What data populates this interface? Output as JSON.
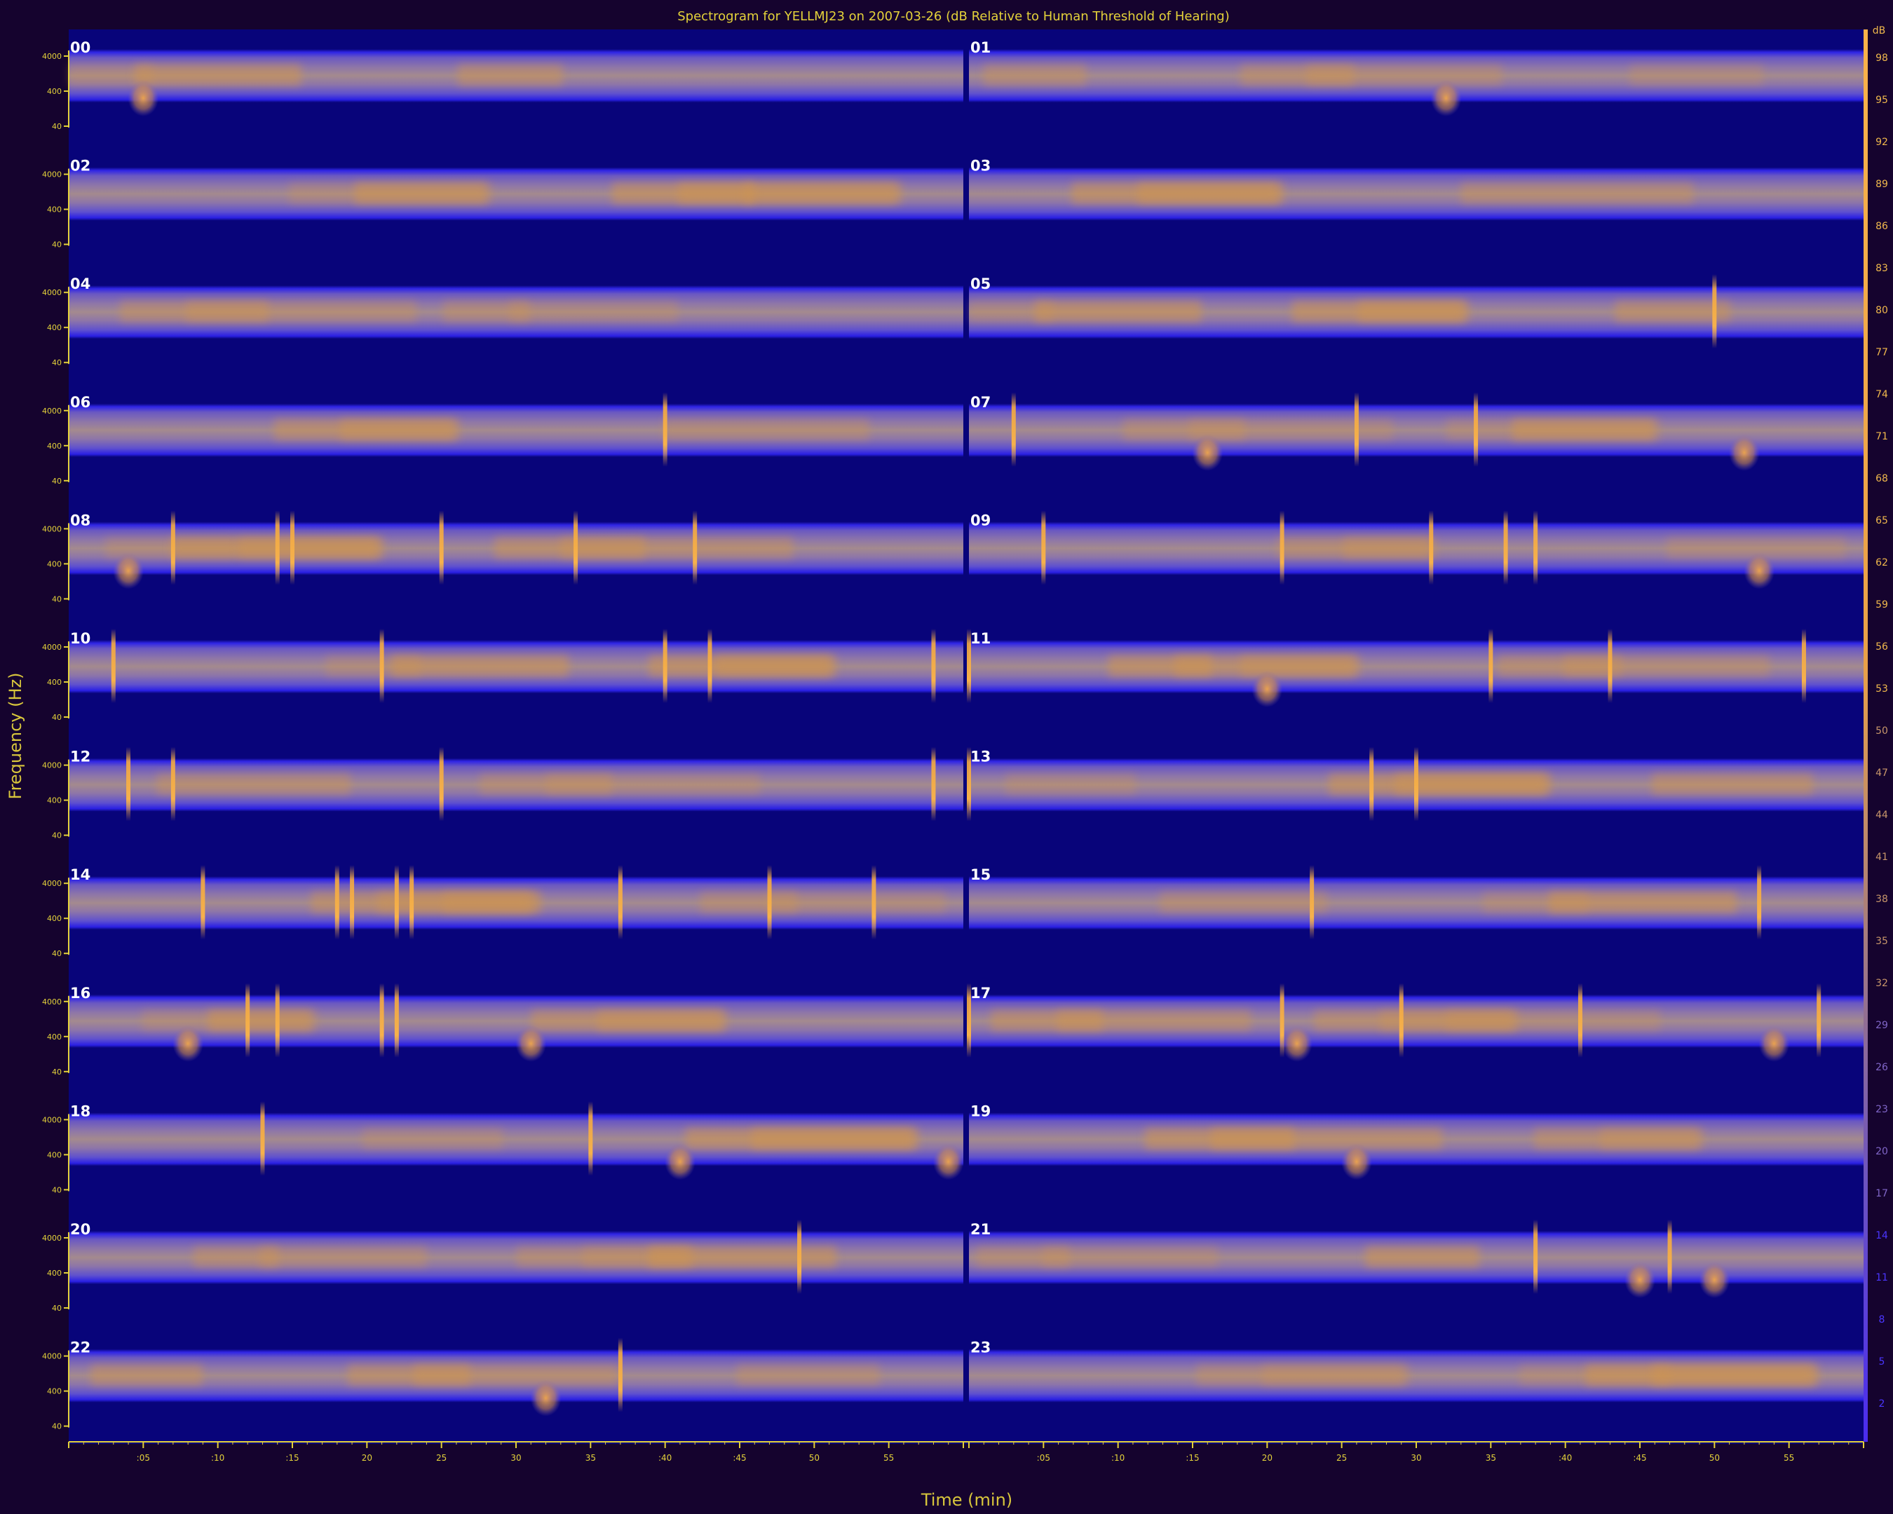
{
  "chart_data": {
    "type": "heatmap",
    "title": "Spectrogram for YELLMJ23 on 2007-03-26 (dB Relative to Human Threshold of Hearing)",
    "xlabel": "Time (min)",
    "ylabel": "Frequency (Hz)",
    "hours": [
      "00",
      "01",
      "02",
      "03",
      "04",
      "05",
      "06",
      "07",
      "08",
      "09",
      "10",
      "11",
      "12",
      "13",
      "14",
      "15",
      "16",
      "17",
      "18",
      "19",
      "20",
      "21",
      "22",
      "23"
    ],
    "frequency_ticks": [
      "4000",
      "400",
      "40"
    ],
    "time_ticks": [
      ":05",
      ":10",
      ":15",
      "20",
      "25",
      "30",
      "35",
      ":40",
      ":45",
      "50",
      "55"
    ],
    "colorbar": {
      "labels": [
        "98",
        "95",
        "92",
        "89",
        "86",
        "83",
        "80",
        "77",
        "74",
        "71",
        "68",
        "65",
        "62",
        "59",
        "56",
        "53",
        "50",
        "47",
        "44",
        "41",
        "38",
        "35",
        "32",
        "29",
        "26",
        "23",
        "20",
        "17",
        "14",
        "11",
        "8",
        "5",
        "2"
      ],
      "top_label": "dB",
      "colors": [
        "#f8b24a",
        "#e39a47",
        "#b57f6c",
        "#7d63b4",
        "#3f33dd",
        "#1a10b8",
        "#08047a"
      ]
    },
    "events": [
      {
        "hour": "06",
        "minute": 40,
        "type": "spike"
      },
      {
        "hour": "07",
        "minute": 3,
        "type": "spike"
      },
      {
        "hour": "07",
        "minute": 26,
        "type": "spike"
      },
      {
        "hour": "07",
        "minute": 34,
        "type": "spike"
      },
      {
        "hour": "08",
        "minute": 7,
        "type": "spike"
      },
      {
        "hour": "08",
        "minute": 14,
        "type": "spike"
      },
      {
        "hour": "08",
        "minute": 15,
        "type": "spike"
      },
      {
        "hour": "08",
        "minute": 25,
        "type": "spike"
      },
      {
        "hour": "08",
        "minute": 34,
        "type": "spike"
      },
      {
        "hour": "08",
        "minute": 42,
        "type": "spike"
      },
      {
        "hour": "09",
        "minute": 5,
        "type": "spike"
      },
      {
        "hour": "09",
        "minute": 21,
        "type": "spike"
      },
      {
        "hour": "09",
        "minute": 31,
        "type": "spike"
      },
      {
        "hour": "09",
        "minute": 36,
        "type": "spike"
      },
      {
        "hour": "09",
        "minute": 38,
        "type": "spike"
      },
      {
        "hour": "10",
        "minute": 3,
        "type": "spike"
      },
      {
        "hour": "10",
        "minute": 21,
        "type": "spike"
      },
      {
        "hour": "10",
        "minute": 40,
        "type": "spike"
      },
      {
        "hour": "10",
        "minute": 43,
        "type": "spike"
      },
      {
        "hour": "10",
        "minute": 58,
        "type": "spike"
      },
      {
        "hour": "11",
        "minute": 0,
        "type": "spike"
      },
      {
        "hour": "11",
        "minute": 35,
        "type": "spike"
      },
      {
        "hour": "11",
        "minute": 43,
        "type": "spike"
      },
      {
        "hour": "11",
        "minute": 56,
        "type": "spike"
      },
      {
        "hour": "12",
        "minute": 4,
        "type": "spike"
      },
      {
        "hour": "12",
        "minute": 7,
        "type": "spike"
      },
      {
        "hour": "12",
        "minute": 25,
        "type": "spike"
      },
      {
        "hour": "12",
        "minute": 58,
        "type": "spike"
      },
      {
        "hour": "13",
        "minute": 0,
        "type": "spike"
      },
      {
        "hour": "13",
        "minute": 27,
        "type": "spike"
      },
      {
        "hour": "13",
        "minute": 30,
        "type": "spike"
      },
      {
        "hour": "14",
        "minute": 9,
        "type": "spike"
      },
      {
        "hour": "14",
        "minute": 18,
        "type": "spike"
      },
      {
        "hour": "14",
        "minute": 19,
        "type": "spike"
      },
      {
        "hour": "14",
        "minute": 22,
        "type": "spike"
      },
      {
        "hour": "14",
        "minute": 23,
        "type": "spike"
      },
      {
        "hour": "14",
        "minute": 37,
        "type": "spike"
      },
      {
        "hour": "14",
        "minute": 47,
        "type": "spike"
      },
      {
        "hour": "14",
        "minute": 54,
        "type": "spike"
      },
      {
        "hour": "15",
        "minute": 23,
        "type": "spike"
      },
      {
        "hour": "15",
        "minute": 53,
        "type": "spike"
      },
      {
        "hour": "16",
        "minute": 12,
        "type": "spike"
      },
      {
        "hour": "16",
        "minute": 14,
        "type": "spike"
      },
      {
        "hour": "16",
        "minute": 21,
        "type": "spike"
      },
      {
        "hour": "16",
        "minute": 22,
        "type": "spike"
      },
      {
        "hour": "17",
        "minute": 0,
        "type": "spike"
      },
      {
        "hour": "17",
        "minute": 21,
        "type": "spike"
      },
      {
        "hour": "17",
        "minute": 29,
        "type": "spike"
      },
      {
        "hour": "17",
        "minute": 41,
        "type": "spike"
      },
      {
        "hour": "17",
        "minute": 57,
        "type": "spike"
      },
      {
        "hour": "18",
        "minute": 13,
        "type": "spike"
      },
      {
        "hour": "18",
        "minute": 35,
        "type": "spike"
      },
      {
        "hour": "20",
        "minute": 49,
        "type": "spike"
      },
      {
        "hour": "21",
        "minute": 38,
        "type": "spike"
      },
      {
        "hour": "21",
        "minute": 47,
        "type": "spike"
      },
      {
        "hour": "22",
        "minute": 37,
        "type": "spike"
      },
      {
        "hour": "05",
        "minute": 50,
        "type": "spike"
      },
      {
        "hour": "00",
        "minute": 5,
        "type": "blob"
      },
      {
        "hour": "01",
        "minute": 32,
        "type": "blob"
      },
      {
        "hour": "07",
        "minute": 16,
        "type": "blob"
      },
      {
        "hour": "07",
        "minute": 52,
        "type": "blob"
      },
      {
        "hour": "08",
        "minute": 4,
        "type": "blob"
      },
      {
        "hour": "09",
        "minute": 53,
        "type": "blob"
      },
      {
        "hour": "11",
        "minute": 20,
        "type": "blob"
      },
      {
        "hour": "16",
        "minute": 8,
        "type": "blob"
      },
      {
        "hour": "16",
        "minute": 31,
        "type": "blob"
      },
      {
        "hour": "17",
        "minute": 22,
        "type": "blob"
      },
      {
        "hour": "17",
        "minute": 54,
        "type": "blob"
      },
      {
        "hour": "18",
        "minute": 41,
        "type": "blob"
      },
      {
        "hour": "18",
        "minute": 59,
        "type": "blob"
      },
      {
        "hour": "19",
        "minute": 26,
        "type": "blob"
      },
      {
        "hour": "21",
        "minute": 45,
        "type": "blob"
      },
      {
        "hour": "21",
        "minute": 50,
        "type": "blob"
      },
      {
        "hour": "22",
        "minute": 32,
        "type": "blob"
      }
    ]
  }
}
